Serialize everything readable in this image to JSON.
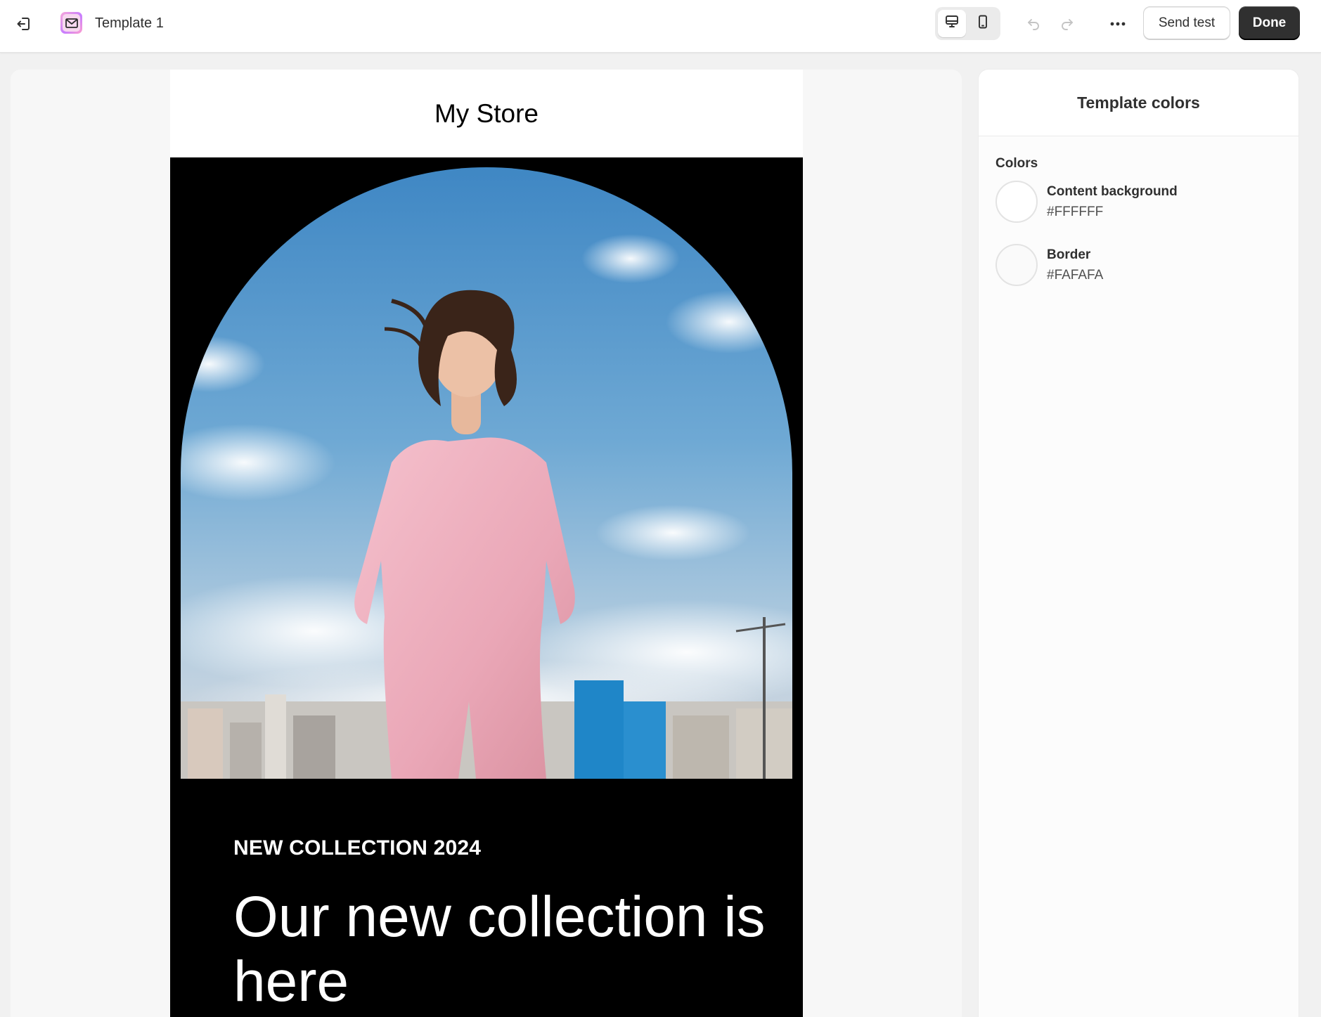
{
  "header": {
    "template_name": "Template 1",
    "send_test_label": "Send test",
    "done_label": "Done"
  },
  "icons": {
    "exit": "exit-icon",
    "app": "email-app-icon",
    "desktop": "desktop-icon",
    "mobile": "mobile-icon",
    "undo": "undo-icon",
    "redo": "redo-icon",
    "more": "more-horizontal-icon"
  },
  "email": {
    "store_name": "My Store",
    "eyebrow": "NEW COLLECTION 2024",
    "headline": "Our new collection is here"
  },
  "panel": {
    "title": "Template colors",
    "section_label": "Colors",
    "colors": [
      {
        "name": "Content background",
        "hex": "#FFFFFF"
      },
      {
        "name": "Border",
        "hex": "#FAFAFA"
      }
    ]
  },
  "theme": {
    "primary_button": "#303030",
    "hero_background": "#000000"
  }
}
